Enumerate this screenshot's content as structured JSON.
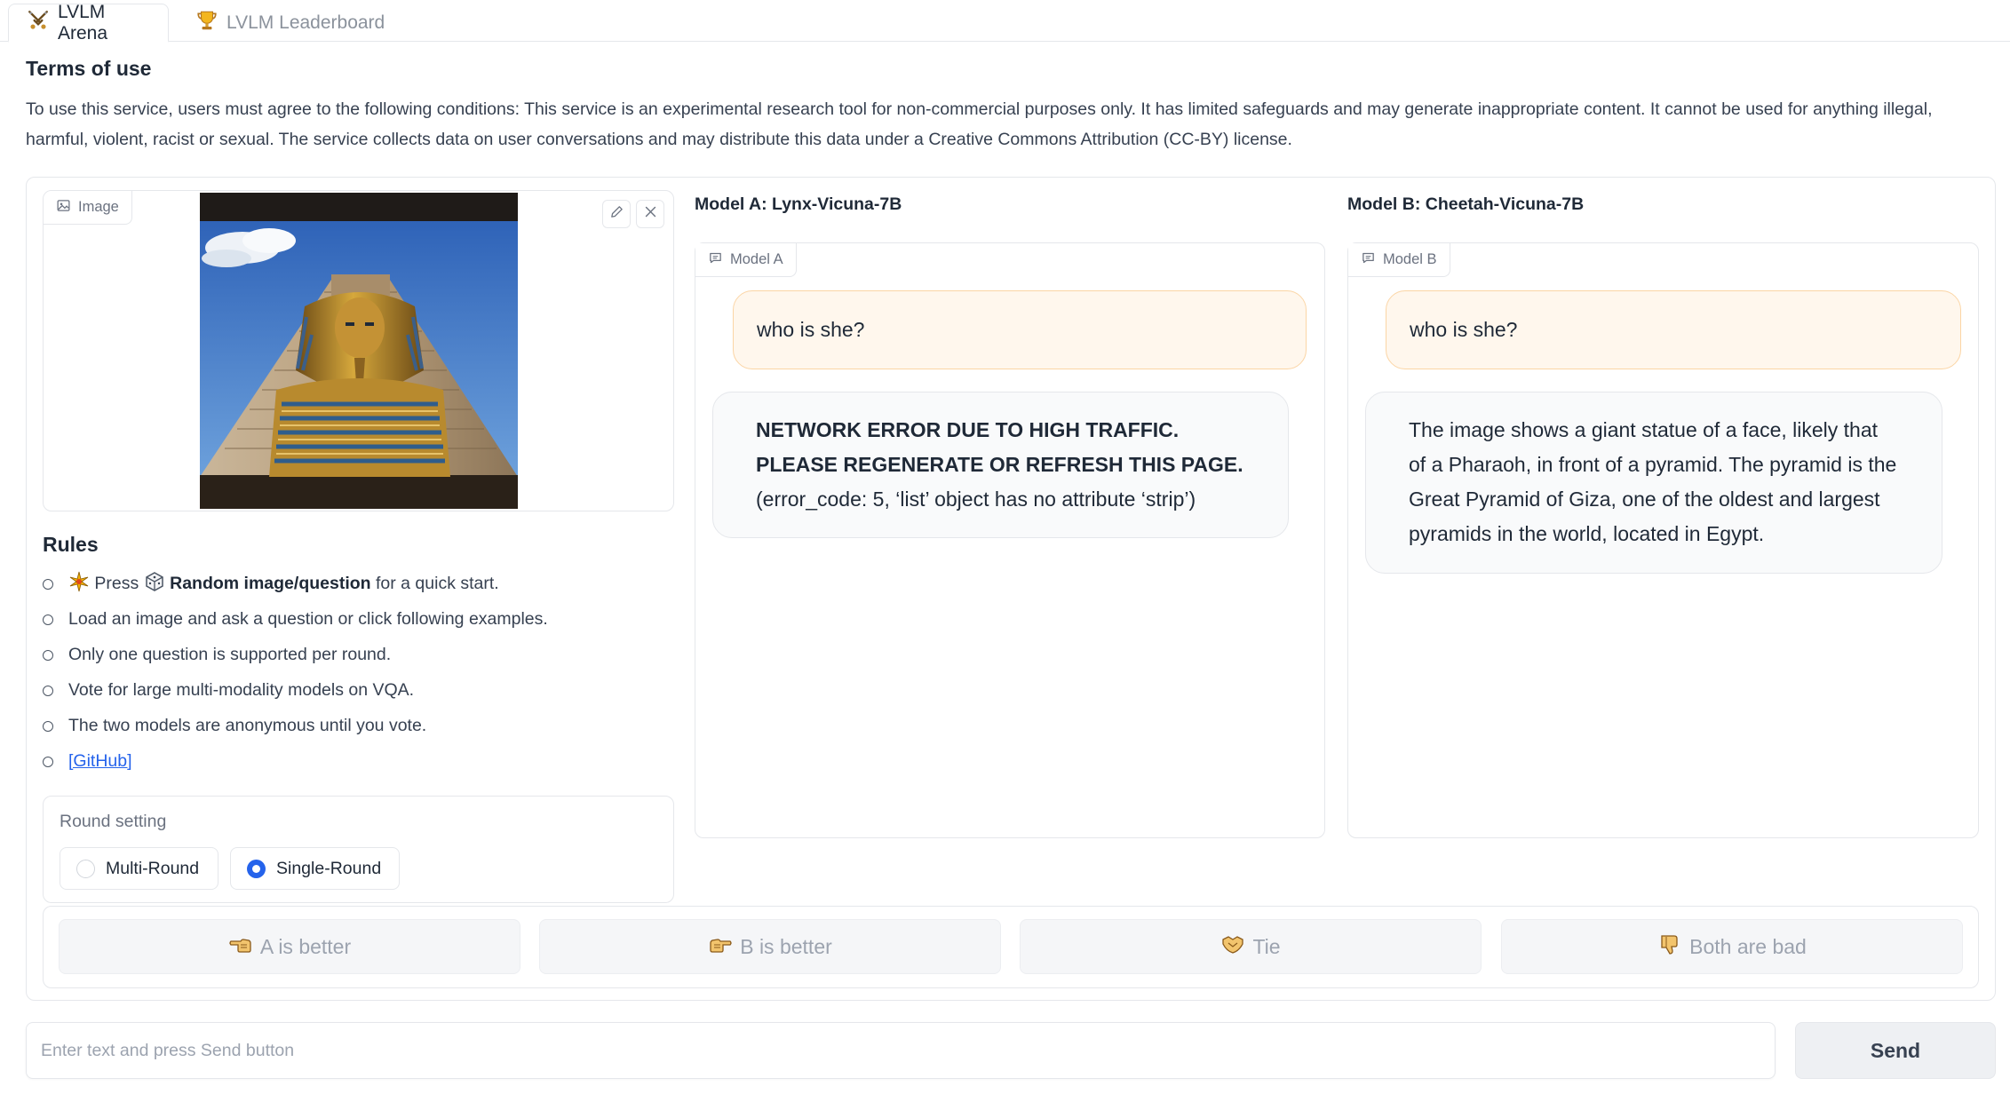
{
  "tabs": [
    {
      "label": "LVLM Arena",
      "icon": "crossed-swords-icon",
      "active": true
    },
    {
      "label": "LVLM Leaderboard",
      "icon": "trophy-icon",
      "active": false
    }
  ],
  "terms": {
    "title": "Terms of use",
    "text": "To use this service, users must agree to the following conditions: This service is an experimental research tool for non-commercial purposes only. It has limited safeguards and may generate inappropriate content. It cannot be used for anything illegal, harmful, violent, racist or sexual. The service collects data on user conversations and may distribute this data under a Creative Commons Attribution (CC-BY) license."
  },
  "image_input": {
    "label": "Image",
    "uploaded_image": "pharaoh statue in front of a pyramid"
  },
  "rules": {
    "title": "Rules",
    "items": {
      "r1_press": "Press",
      "r1_bold": "Random image/question",
      "r1_rest": "for a quick start.",
      "r2": "Load an image and ask a question or click following examples.",
      "r3": "Only one question is supported per round.",
      "r4": "Vote for large multi-modality models on VQA.",
      "r5": "The two models are anonymous until you vote.",
      "r6_link": "[GitHub]"
    }
  },
  "round_setting": {
    "label": "Round setting",
    "options": [
      "Multi-Round",
      "Single-Round"
    ],
    "selected": "Single-Round"
  },
  "model_a": {
    "title": "Model A: Lynx-Vicuna-7B",
    "chip": "Model A",
    "user_msg": "who is she?",
    "bot_bold": "NETWORK ERROR DUE TO HIGH TRAFFIC. PLEASE REGENERATE OR REFRESH THIS PAGE.",
    "bot_rest": "(error_code: 5, ‘list’ object has no attribute ‘strip’)"
  },
  "model_b": {
    "title": "Model B: Cheetah-Vicuna-7B",
    "chip": "Model B",
    "user_msg": "who is she?",
    "bot_text": "The image shows a giant statue of a face, likely that of a Pharaoh, in front of a pyramid. The pyramid is the Great Pyramid of Giza, one of the oldest and largest pyramids in the world, located in Egypt."
  },
  "vote": {
    "a_better": "A is better",
    "b_better": "B is better",
    "tie": "Tie",
    "both_bad": "Both are bad"
  },
  "input": {
    "placeholder": "Enter text and press Send button",
    "value": "",
    "send_label": "Send"
  },
  "colors": {
    "user_bubble_bg": "#fff7ed",
    "user_bubble_border": "#fbd5a5",
    "bot_bubble_bg": "#f9fafb",
    "radio_selected": "#2563eb",
    "link": "#2563eb"
  }
}
